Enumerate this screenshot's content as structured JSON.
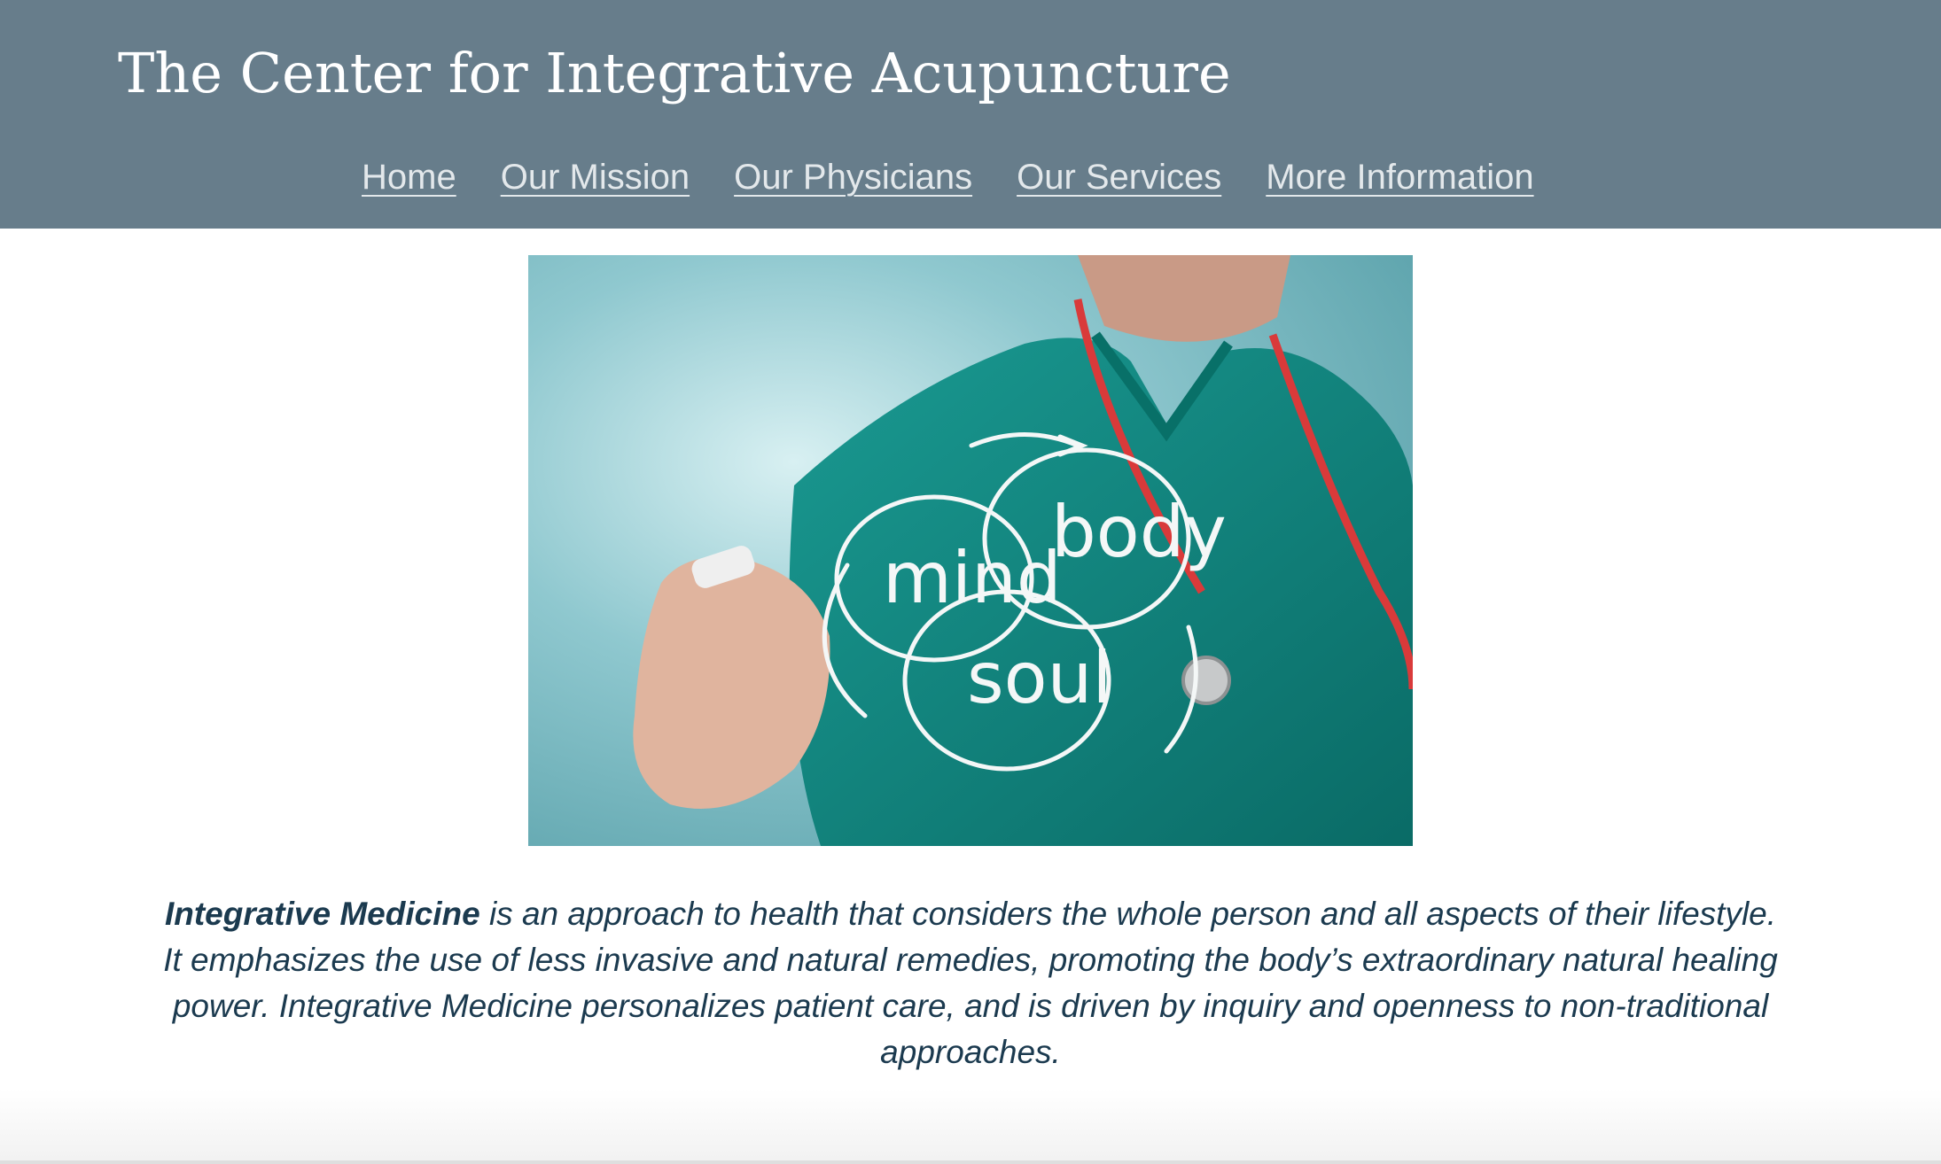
{
  "header": {
    "site_title": "The Center for Integrative Acupuncture",
    "nav": [
      {
        "label": "Home"
      },
      {
        "label": "Our Mission"
      },
      {
        "label": "Our Physicians"
      },
      {
        "label": "Our Services"
      },
      {
        "label": "More Information"
      }
    ]
  },
  "hero": {
    "words": [
      "mind",
      "body",
      "soul"
    ]
  },
  "intro": {
    "term": "Integrative Medicine",
    "text": " is an approach to health that considers the whole person and all aspects of their lifestyle. It emphasizes the use of less invasive and natural remedies, promoting the body’s extraordinary natural healing power. Integrative Medicine personalizes patient care, and is driven by inquiry and openness to non-traditional approaches."
  },
  "colors": {
    "header_bg": "#677d8b",
    "nav_link": "#e3e8eb",
    "body_text": "#1b3a4f"
  }
}
